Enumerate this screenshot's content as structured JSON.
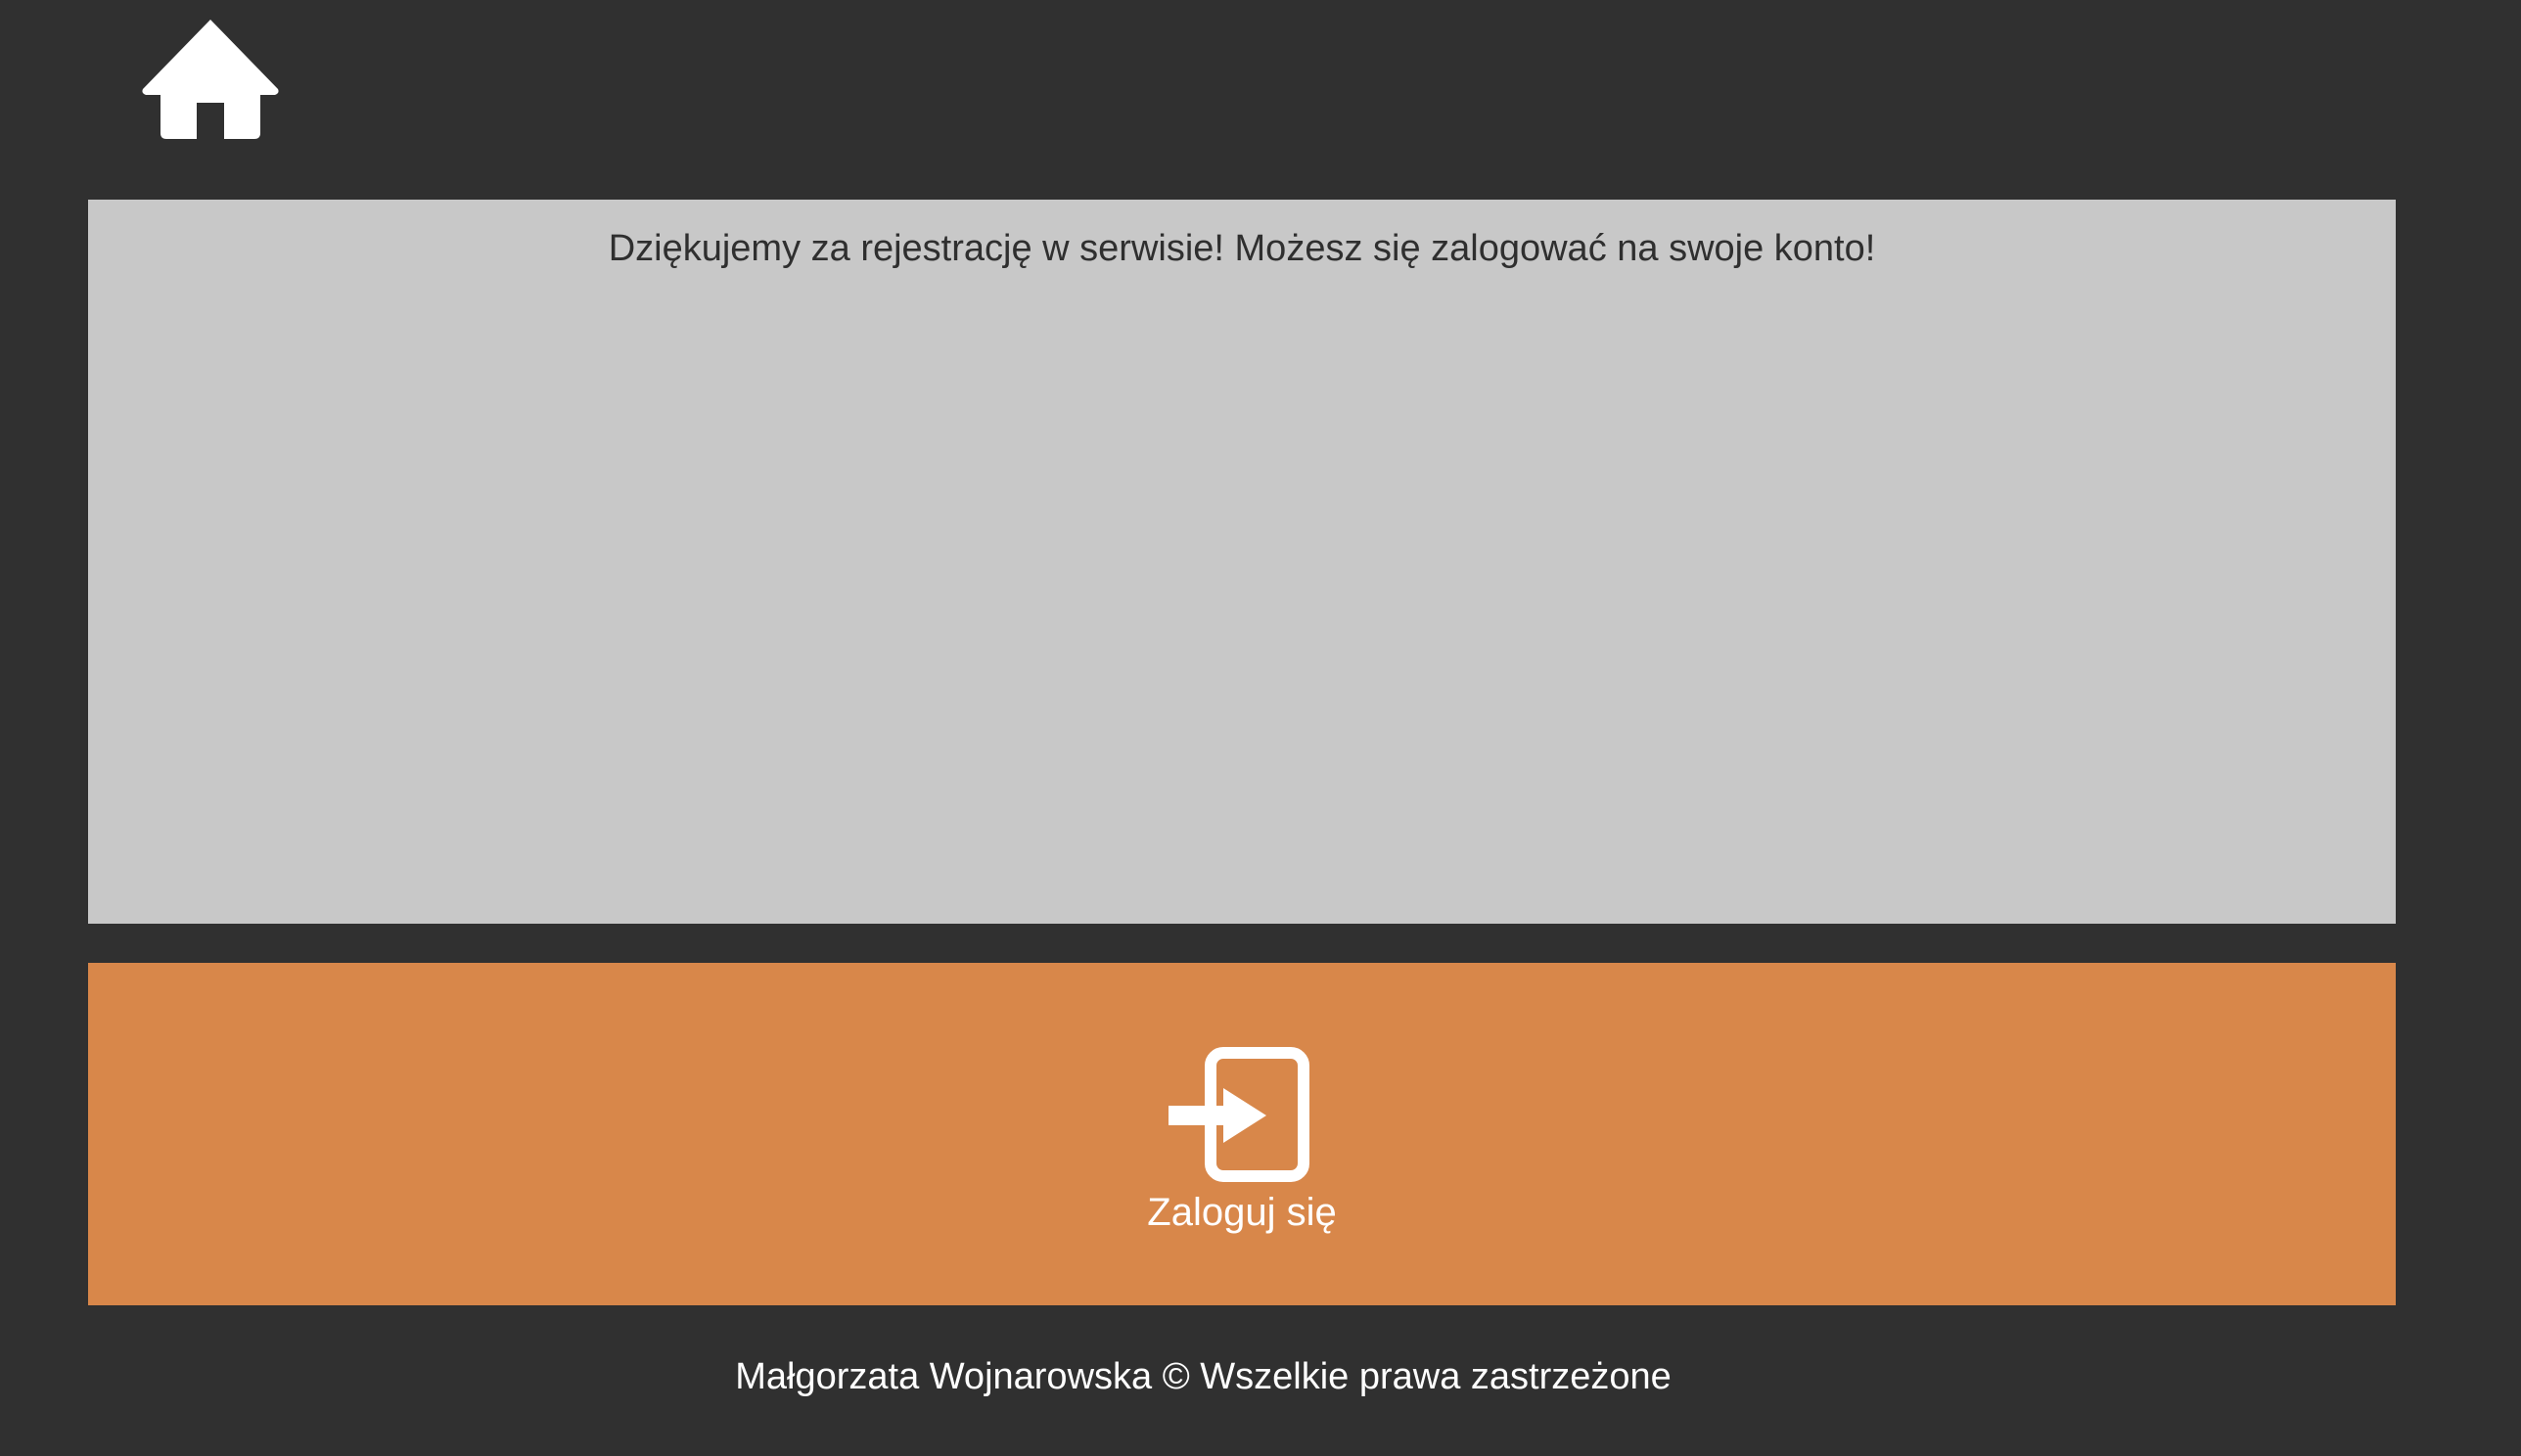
{
  "header": {
    "home_icon": "home-icon"
  },
  "message": {
    "text": "Dziękujemy za rejestrację w serwisie! Możesz się zalogować na swoje konto!"
  },
  "login": {
    "icon": "sign-in-icon",
    "label": "Zaloguj się"
  },
  "footer": {
    "text": "Małgorzata Wojnarowska © Wszelkie prawa zastrzeżone"
  },
  "colors": {
    "background": "#303030",
    "panel": "#c8c8c8",
    "accent": "#d8874a",
    "icon": "#ffffff"
  }
}
